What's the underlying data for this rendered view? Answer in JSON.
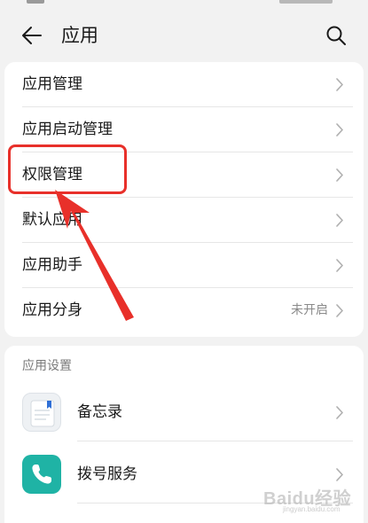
{
  "header": {
    "title": "应用",
    "back_icon": "arrow-left-icon",
    "search_icon": "search-icon"
  },
  "menu": {
    "items": [
      {
        "label": "应用管理",
        "value": ""
      },
      {
        "label": "应用启动管理",
        "value": ""
      },
      {
        "label": "权限管理",
        "value": ""
      },
      {
        "label": "默认应用",
        "value": ""
      },
      {
        "label": "应用助手",
        "value": ""
      },
      {
        "label": "应用分身",
        "value": "未开启"
      }
    ]
  },
  "app_settings": {
    "section_title": "应用设置",
    "items": [
      {
        "label": "备忘录",
        "icon": "notepad-icon"
      },
      {
        "label": "拨号服务",
        "icon": "phone-icon"
      }
    ]
  },
  "watermark": {
    "brand": "Baidu经验",
    "url": "jingyan.baidu.com"
  },
  "colors": {
    "highlight": "#e8302a",
    "dial_icon": "#1fb3a5"
  }
}
